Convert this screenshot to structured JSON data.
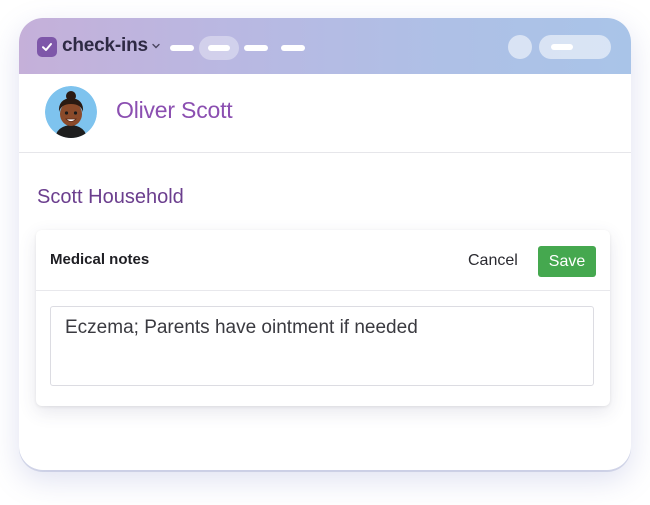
{
  "app": {
    "name": "check-ins",
    "colors": {
      "brand": "#7e57a9",
      "accent": "#8b4fb1",
      "save": "#45a84f"
    }
  },
  "person": {
    "name": "Oliver Scott"
  },
  "household": {
    "name": "Scott Household"
  },
  "notes_card": {
    "title": "Medical notes",
    "cancel_label": "Cancel",
    "save_label": "Save",
    "value": "Eczema; Parents have ointment if needed"
  }
}
